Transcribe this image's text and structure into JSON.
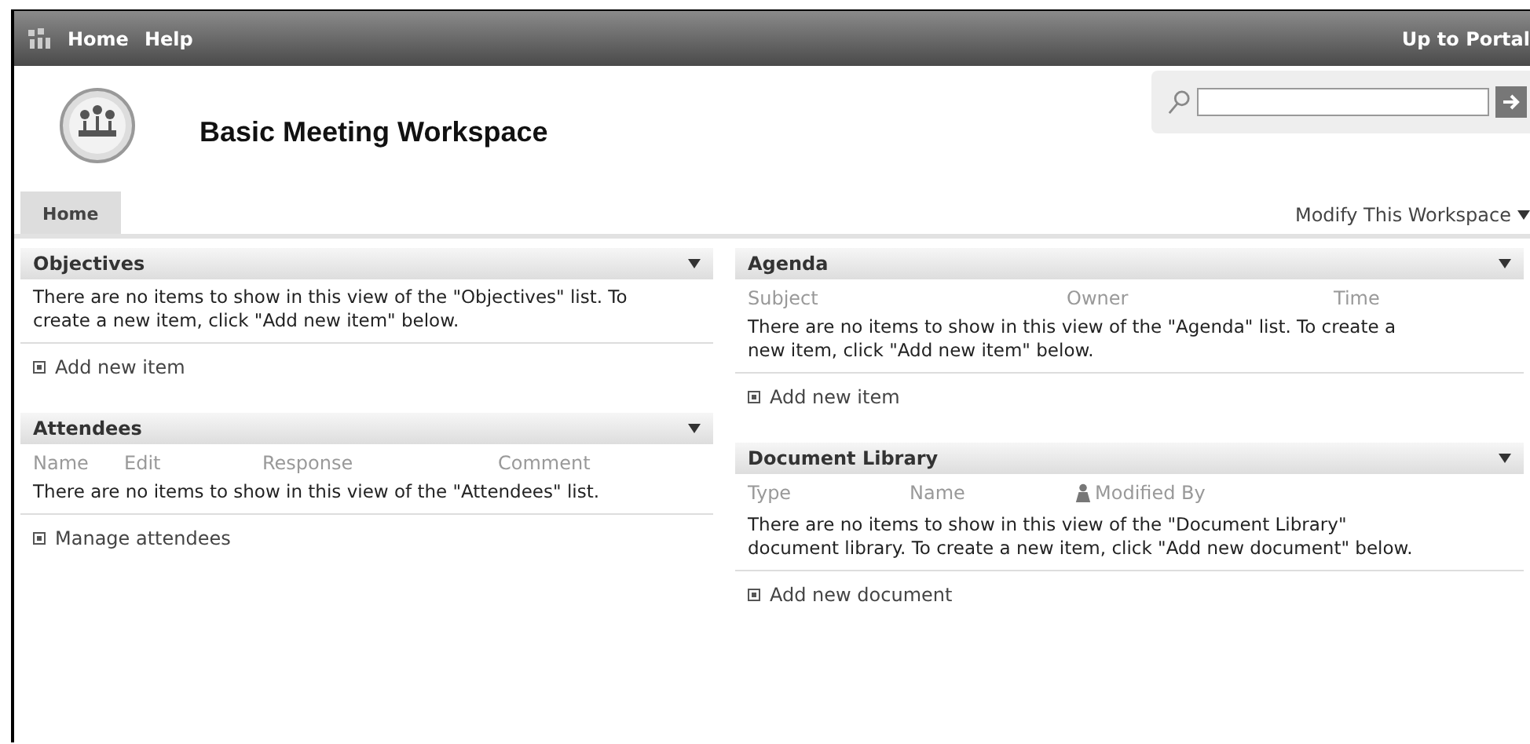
{
  "top_bar": {
    "links": [
      "Home",
      "Help"
    ],
    "portal_link": "Up to Portal"
  },
  "site": {
    "title": "Basic Meeting Workspace"
  },
  "tabs": [
    {
      "label": "Home",
      "selected": true
    }
  ],
  "modify_menu": "Modify This Workspace",
  "columns": [
    [
      {
        "title": "Objectives",
        "message": "There are no items to show in this view of the \"Objectives\" list. To create a new item, click \"Add new item\" below.",
        "link": "Add new item"
      },
      {
        "title": "Attendees",
        "headers": [
          {
            "label": "Name",
            "kind": "text"
          },
          {
            "label": "Edit",
            "kind": "text"
          },
          {
            "label": "Response",
            "kind": "text"
          },
          {
            "label": "Comment",
            "kind": "text"
          }
        ],
        "message": "There are no items to show in this view of the \"Attendees\" list.",
        "link": "Manage attendees"
      }
    ],
    [
      {
        "title": "Agenda",
        "headers": [
          {
            "label": "Subject",
            "kind": "text"
          },
          {
            "label": "Owner",
            "kind": "text"
          },
          {
            "label": "Time",
            "kind": "text"
          }
        ],
        "message": "There are no items to show in this view of the \"Agenda\" list. To create a new item, click \"Add new item\" below.",
        "link": "Add new item"
      },
      {
        "title": "Document Library",
        "headers": [
          {
            "label": "Type",
            "kind": "text"
          },
          {
            "label": "Name",
            "kind": "text"
          },
          {
            "label": "Modified By",
            "kind": "user"
          }
        ],
        "message": "There are no items to show in this view of the \"Document Library\" document library. To create a new item, click \"Add new document\" below.",
        "link": "Add new document"
      }
    ]
  ]
}
